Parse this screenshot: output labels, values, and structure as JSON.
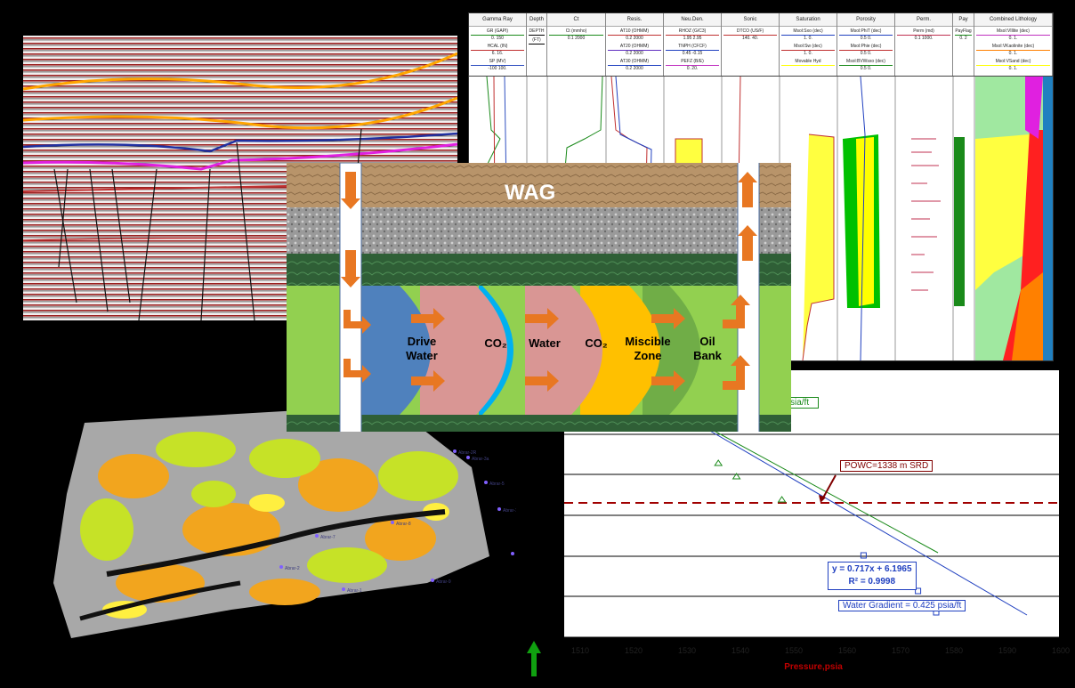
{
  "well_log": {
    "tracks": [
      {
        "name": "Gamma Ray",
        "curves": [
          "GR (GAPI)",
          "HCAL (IN)",
          "SP (MV)"
        ],
        "scales": [
          "0.  150",
          "6.  16.",
          "-100  100."
        ],
        "colors": [
          "#1a8a1a",
          "#c03030",
          "#3050c0"
        ]
      },
      {
        "name": "Depth",
        "curves": [
          "DEPTH",
          "(FT)"
        ],
        "scales": [
          "",
          ""
        ],
        "colors": [
          "#000",
          "#000"
        ]
      },
      {
        "name": "Ct",
        "curves": [
          "Ct (mmho)"
        ],
        "scales": [
          "0.1  2000"
        ],
        "colors": [
          "#1a8a1a"
        ]
      },
      {
        "name": "Resis.",
        "curves": [
          "AT10 (OHMM)",
          "AT20 (OHMM)",
          "AT30 (OHMM)"
        ],
        "scales": [
          "0.2  2000",
          "0.2  2000",
          "0.2  2000"
        ],
        "colors": [
          "#c03030",
          "#6030c0",
          "#2040c0"
        ]
      },
      {
        "name": "Neu.Den.",
        "curves": [
          "RHOZ (G/C3)",
          "TNPH (CFCF)",
          "PEFZ (B/E)"
        ],
        "scales": [
          "1.95  2.95",
          "0.45  -0.15",
          "0.  20."
        ],
        "colors": [
          "#c03030",
          "#2040c0",
          "#c030c0"
        ]
      },
      {
        "name": "Sonic",
        "curves": [
          "DTCO (US/F)"
        ],
        "scales": [
          "140.  40."
        ],
        "colors": [
          "#c03030"
        ]
      },
      {
        "name": "Saturation",
        "curves": [
          "Msol:Sxo (dec)",
          "Msol:Sw (dec)",
          "Movable Hyd"
        ],
        "scales": [
          "1.  0.",
          "1.  0.",
          ""
        ],
        "colors": [
          "#2040c0",
          "#c03030",
          "#ffff00"
        ]
      },
      {
        "name": "Porosity",
        "curves": [
          "Msol:PhiT (dec)",
          "Msol:Phie (dec)",
          "Msol:BVWsxo (dec)"
        ],
        "scales": [
          "0.5  0.",
          "0.5  0.",
          "0.5  0."
        ],
        "colors": [
          "#2040c0",
          "#c03030",
          "#1a8a1a"
        ]
      },
      {
        "name": "Perm.",
        "curves": [
          "Perm (md)"
        ],
        "scales": [
          "0.1  1000."
        ],
        "colors": [
          "#c03050"
        ]
      },
      {
        "name": "Pay",
        "curves": [
          "PayFlag"
        ],
        "scales": [
          "0.  2"
        ],
        "colors": [
          "#1a8a1a"
        ]
      },
      {
        "name": "Combined Lithology",
        "curves": [
          "Msol:VIllite (dec)",
          "Msol:VKaolinite (dec)",
          "Msol:VSand (dec)"
        ],
        "scales": [
          "0.  1.",
          "0.  1.",
          "0.  1."
        ],
        "colors": [
          "#c030c0",
          "#ff8000",
          "#ffff00"
        ]
      }
    ]
  },
  "wag": {
    "title": "WAG",
    "zones": [
      {
        "label_lines": [
          "Drive",
          "Water"
        ],
        "color": "#4f81bd"
      },
      {
        "label_lines": [
          "CO₂"
        ],
        "color": "#d99694"
      },
      {
        "label_lines": [
          "Water"
        ],
        "color": "#00b0f0"
      },
      {
        "label_lines": [
          "CO₂"
        ],
        "color": "#d99694"
      },
      {
        "label_lines": [
          "Miscible",
          "Zone"
        ],
        "color": "#ffc000"
      },
      {
        "label_lines": [
          "Oil",
          "Bank"
        ],
        "color": "#70ad47"
      }
    ]
  },
  "chart_data": {
    "type": "scatter",
    "xlabel": "Pressure,psia",
    "x_ticks": [
      "1510",
      "1520",
      "1530",
      "1540",
      "1550",
      "1560",
      "1570",
      "1580",
      "1590",
      "1600"
    ],
    "annotations": {
      "gradient_partial": "sia/ft",
      "powc": "POWC=1338 m SRD",
      "equation": "y = 0.717x + 6.1965",
      "r2": "R² = 0.9998",
      "water_gradient": "Water Gradient = 0.425 psia/ft"
    },
    "series": [
      {
        "name": "oil_points",
        "color": "#1a8a1a",
        "points": [
          [
            1542,
            1
          ],
          [
            1546,
            2
          ],
          [
            1556,
            3
          ]
        ]
      },
      {
        "name": "water_points",
        "color": "#2040c0",
        "points": [
          [
            1574,
            5
          ],
          [
            1578,
            6
          ],
          [
            1586,
            7
          ],
          [
            1590,
            8
          ]
        ]
      }
    ]
  },
  "map_labels": [
    "Abrar-2R",
    "Abrar-3a",
    "Abrar-5",
    "Abrar-11",
    "Abrar-17",
    "Abrar-2",
    "Abrar-7",
    "Abrar-8",
    "Abrar-9",
    "Abrar-1"
  ]
}
